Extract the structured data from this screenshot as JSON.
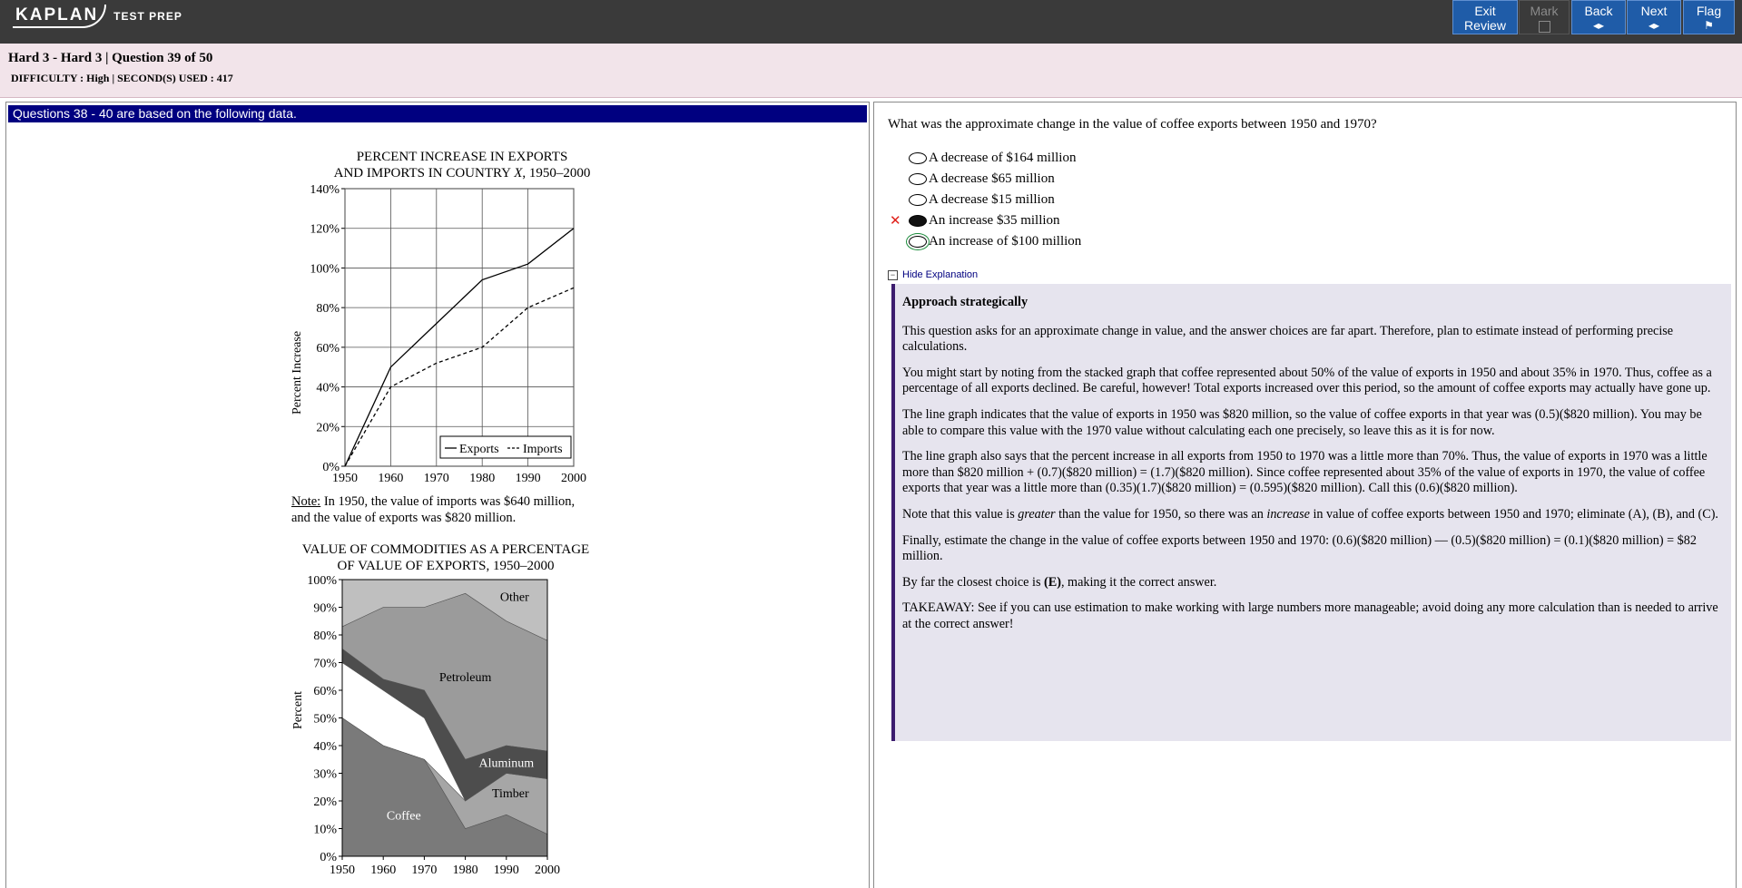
{
  "header": {
    "logo_text": "KAPLAN",
    "logo_suffix": "TEST PREP",
    "buttons": {
      "exit_review_line1": "Exit",
      "exit_review_line2": "Review",
      "mark": "Mark",
      "back": "Back",
      "next": "Next",
      "flag": "Flag"
    }
  },
  "info": {
    "title": "Hard 3 - Hard 3 | Question  39 of 50",
    "subtitle": "DIFFICULTY : High | SECOND(S) USED : 417"
  },
  "stimulus": {
    "header": "Questions 38 - 40 are based on the following data.",
    "note_label": "Note:",
    "note_text": " In 1950, the value of imports was $640 million,",
    "note_text2": "and the value of exports was $820 million."
  },
  "question": {
    "stem": "What was the approximate change in the value of coffee exports between 1950 and 1970?",
    "choices": [
      "A decrease of $164 million",
      "A decrease $65 million",
      "A decrease $15 million",
      "An increase $35 million",
      "An increase of $100 million"
    ],
    "selected_index": 3,
    "incorrect_mark": "✕"
  },
  "explanation": {
    "toggle_label": "Hide Explanation",
    "toggle_icon": "−",
    "heading": "Approach strategically",
    "p1": "This question asks for an approximate change in value, and the answer choices are far apart. Therefore, plan to estimate instead of performing precise calculations.",
    "p2": "You might start by noting from the stacked graph that coffee represented about 50% of the value of exports in 1950 and about 35% in 1970. Thus, coffee as a percentage of all exports declined. Be careful, however! Total exports increased over this period, so the amount of coffee exports may actually have gone up.",
    "p3": "The line graph indicates that the value of exports in 1950 was $820 million, so the value of coffee exports in that year was (0.5)($820 million). You may be able to compare this value with the 1970 value without calculating each one precisely, so leave this as it is for now.",
    "p4": "The line graph also says that the percent increase in all exports from 1950 to 1970 was a little more than 70%. Thus, the value of exports in 1970 was a little more than $820 million + (0.7)($820 million) = (1.7)($820 million). Since coffee represented about 35% of the value of exports in 1970, the value of coffee exports that year was a little more than (0.35)(1.7)($820 million) = (0.595)($820 million). Call this (0.6)($820 million).",
    "p5_a": "Note that this value is ",
    "p5_b": "greater",
    "p5_c": " than the value for 1950, so there was an ",
    "p5_d": "increase",
    "p5_e": " in value of coffee exports between 1950 and 1970; eliminate (A), (B), and (C).",
    "p6": "Finally, estimate the change in the value of coffee exports between 1950 and 1970: (0.6)($820 million) — (0.5)($820 million) = (0.1)($820 million) = $82 million.",
    "p7_a": "By far the closest choice is ",
    "p7_b": "(E)",
    "p7_c": ", making it the correct answer.",
    "p8": "TAKEAWAY: See if you can use estimation to make working with large numbers more manageable; avoid doing any more calculation than is needed to arrive at the correct answer!"
  },
  "chart_data": [
    {
      "type": "line",
      "title_line1": "PERCENT INCREASE IN EXPORTS",
      "title_line2_a": "AND IMPORTS IN COUNTRY ",
      "title_line2_b": "X",
      "title_line2_c": ", 1950–2000",
      "xlabel": "",
      "ylabel": "Percent Increase",
      "x": [
        1950,
        1960,
        1970,
        1980,
        1990,
        2000
      ],
      "ylim": [
        0,
        140
      ],
      "yticks": [
        "0%",
        "20%",
        "40%",
        "60%",
        "80%",
        "100%",
        "120%",
        "140%"
      ],
      "ytick_values": [
        0,
        20,
        40,
        60,
        80,
        100,
        120,
        140
      ],
      "grid": true,
      "legend_placement": "bottom-right",
      "series": [
        {
          "name": "Exports",
          "style": "solid",
          "values": [
            0,
            50,
            72,
            94,
            102,
            120
          ]
        },
        {
          "name": "Imports",
          "style": "dashed",
          "values": [
            0,
            40,
            52,
            60,
            80,
            90
          ]
        }
      ]
    },
    {
      "type": "area",
      "title_line1": "VALUE OF COMMODITIES AS A PERCENTAGE",
      "title_line2": "OF VALUE OF EXPORTS, 1950–2000",
      "xlabel": "",
      "ylabel": "Percent",
      "x": [
        1950,
        1960,
        1970,
        1980,
        1990,
        2000
      ],
      "ylim": [
        0,
        100
      ],
      "yticks": [
        "0%",
        "10%",
        "20%",
        "30%",
        "40%",
        "50%",
        "60%",
        "70%",
        "80%",
        "90%",
        "100%"
      ],
      "ytick_values": [
        0,
        10,
        20,
        30,
        40,
        50,
        60,
        70,
        80,
        90,
        100
      ],
      "stacked_boundaries_note": "cumulative percentages (top of each band)",
      "series": [
        {
          "name": "Coffee",
          "color": "#7a7a7a",
          "top": [
            50,
            40,
            35,
            10,
            15,
            8
          ]
        },
        {
          "name": "Timber",
          "color": "#a8a8a8",
          "top": [
            50,
            40,
            35,
            20,
            30,
            28
          ]
        },
        {
          "name": "Aluminum",
          "color": "#4a4a4a",
          "top": [
            70,
            60,
            50,
            35,
            40,
            38
          ]
        },
        {
          "name": "Petroleum",
          "color": "#9a9a9a",
          "top": [
            75,
            64,
            60,
            20,
            38,
            36
          ]
        },
        {
          "name": "Other",
          "color": "#bdbdbd",
          "top": [
            83,
            90,
            90,
            95,
            85,
            78
          ]
        }
      ],
      "bands": [
        {
          "name": "Coffee",
          "color": "#7a7a7a",
          "lower": [
            0,
            0,
            0,
            0,
            0,
            0
          ],
          "upper": [
            50,
            40,
            35,
            10,
            15,
            8
          ]
        },
        {
          "name": "Timber",
          "color": "#a6a6a6",
          "lower": [
            50,
            40,
            35,
            10,
            15,
            8
          ],
          "upper": [
            50,
            40,
            35,
            20,
            30,
            28
          ]
        },
        {
          "name": "Petroleum",
          "color": "#9b9b9b",
          "lower": [
            70,
            60,
            50,
            35,
            40,
            38
          ],
          "upper": [
            83,
            90,
            90,
            95,
            85,
            78
          ]
        },
        {
          "name": "Aluminum",
          "color": "#4d4d4d",
          "lower": [
            70,
            60,
            50,
            20,
            30,
            28
          ],
          "upper": [
            75,
            64,
            60,
            35,
            40,
            38
          ]
        },
        {
          "name": "Other",
          "color": "#bfbfbf",
          "lower": [
            83,
            90,
            90,
            95,
            85,
            78
          ],
          "upper": [
            100,
            100,
            100,
            100,
            100,
            100
          ]
        }
      ],
      "labels": [
        {
          "text": "Other",
          "x": 1992,
          "y": 94
        },
        {
          "text": "Petroleum",
          "x": 1980,
          "y": 65
        },
        {
          "text": "Aluminum",
          "x": 1990,
          "y": 34
        },
        {
          "text": "Timber",
          "x": 1991,
          "y": 23
        },
        {
          "text": "Coffee",
          "x": 1965,
          "y": 15
        }
      ]
    }
  ]
}
